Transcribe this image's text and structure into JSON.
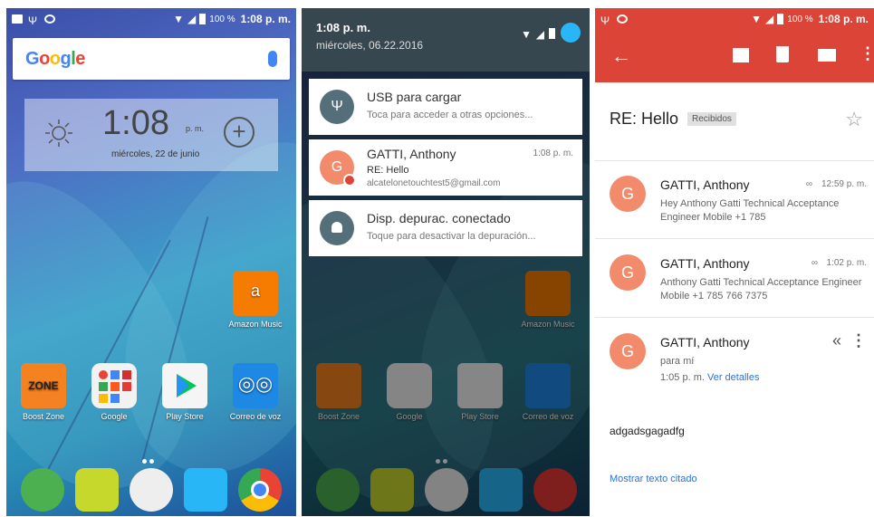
{
  "colors": {
    "gmail_red": "#db4437",
    "avatar_orange": "#f28b6c",
    "link_blue": "#2a73d9",
    "notif_gray": "#546e7a"
  },
  "home": {
    "status": {
      "battery": "100 %",
      "time": "1:08 p. m."
    },
    "google_logo": "Google",
    "clock": {
      "time": "1:08",
      "ampm": "p. m.",
      "date": "miércoles, 22 de junio"
    },
    "apps": [
      {
        "label": "Amazon Music",
        "icon": "amazon-music-icon"
      },
      {
        "label": "Boost Zone",
        "icon": "boost-zone-icon"
      },
      {
        "label": "Google",
        "icon": "google-folder-icon"
      },
      {
        "label": "Play Store",
        "icon": "play-store-icon"
      },
      {
        "label": "Correo de voz",
        "icon": "voicemail-icon"
      }
    ],
    "dock": [
      "phone-icon",
      "camera-icon",
      "app-drawer-icon",
      "messages-icon",
      "chrome-icon"
    ]
  },
  "shade": {
    "time": "1:08 p. m.",
    "date": "miércoles, 06.22.2016",
    "notifications": [
      {
        "title": "USB para cargar",
        "subtitle": "Toca para acceder a otras opciones...",
        "icon": "usb-icon"
      },
      {
        "title": "GATTI, Anthony",
        "time": "1:08 p. m.",
        "subtitle": "RE: Hello",
        "email": "alcatelonetouchtest5@gmail.com",
        "avatar": "G"
      },
      {
        "title": "Disp. depurac. conectado",
        "subtitle": "Toque para desactivar la depuración...",
        "icon": "android-debug-icon"
      }
    ]
  },
  "gmail": {
    "status": {
      "battery": "100 %",
      "time": "1:08 p. m."
    },
    "subject": "RE: Hello",
    "label": "Recibidos",
    "messages": [
      {
        "sender": "GATTI, Anthony",
        "time": "12:59 p. m.",
        "snippet": "Hey Anthony Gatti Technical Acceptance Engineer Mobile +1 785",
        "avatar": "G"
      },
      {
        "sender": "GATTI, Anthony",
        "time": "1:02 p. m.",
        "snippet": "Anthony Gatti Technical Acceptance Engineer Mobile +1 785 766 7375",
        "avatar": "G"
      },
      {
        "sender": "GATTI, Anthony",
        "to": "para mí",
        "time": "1:05 p. m.",
        "details_link": "Ver detalles",
        "avatar": "G"
      }
    ],
    "body": "adgadsgagadfg",
    "show_quoted": "Mostrar texto citado"
  }
}
